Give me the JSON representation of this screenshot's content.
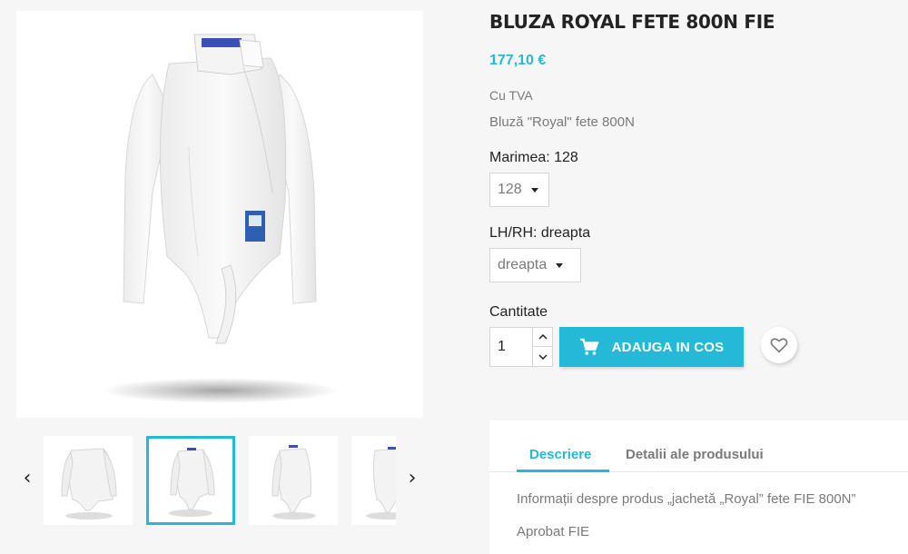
{
  "product": {
    "title": "BLUZA ROYAL FETE 800N FIE",
    "price": "177,10 €",
    "tax_label": "Cu TVA",
    "short_description": "Bluză \"Royal\" fete 800N"
  },
  "variants": {
    "size_label": "Marimea: 128",
    "size_value": "128",
    "hand_label": "LH/RH: dreapta",
    "hand_value": "dreapta"
  },
  "cart": {
    "quantity_label": "Cantitate",
    "quantity_value": "1",
    "add_button_label": "ADAUGA IN COS"
  },
  "tabs": {
    "items": [
      {
        "label": "Descriere",
        "active": true
      },
      {
        "label": "Detalii ale produsului",
        "active": false
      }
    ],
    "description_line1": "Informații despre produs „jachetă „Royal” fete FIE 800N”",
    "description_line2": "Aprobat FIE"
  },
  "gallery": {
    "thumbnails": [
      "jacket-front-thumb",
      "jacket-angle-thumb",
      "jacket-side-thumb",
      "jacket-back-thumb"
    ],
    "selected_index": 1
  },
  "colors": {
    "accent": "#24b9d7",
    "text": "#232323",
    "muted": "#7a7a7a",
    "background": "#f6f6f6"
  },
  "icons": {
    "prev": "chevron-left-icon",
    "next": "chevron-right-icon",
    "cart": "shopping-cart-icon",
    "wishlist": "heart-icon",
    "qty_up": "chevron-up-icon",
    "qty_down": "chevron-down-icon"
  }
}
